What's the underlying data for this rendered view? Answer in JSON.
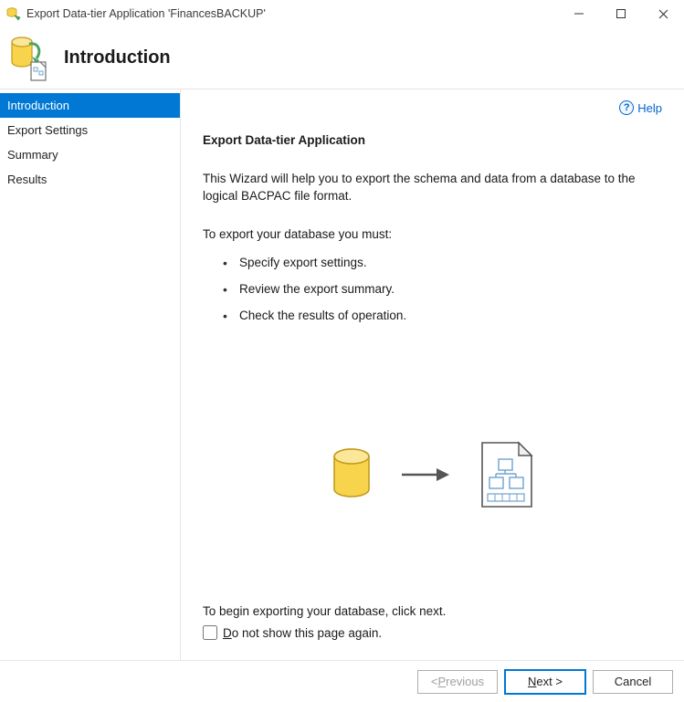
{
  "window": {
    "title": "Export Data-tier Application 'FinancesBACKUP'"
  },
  "header": {
    "title": "Introduction"
  },
  "sidebar": {
    "items": [
      {
        "label": "Introduction",
        "active": true
      },
      {
        "label": "Export Settings",
        "active": false
      },
      {
        "label": "Summary",
        "active": false
      },
      {
        "label": "Results",
        "active": false
      }
    ]
  },
  "help": {
    "label": "Help"
  },
  "content": {
    "heading": "Export Data-tier Application",
    "intro_text": "This Wizard will help you to export the schema and data from a database to the logical BACPAC file format.",
    "steps_lead": "To export your database you must:",
    "steps": [
      "Specify export settings.",
      "Review the export summary.",
      "Check the results of operation."
    ],
    "begin_text": "To begin exporting your database, click next.",
    "checkbox_label": "Do not show this page again."
  },
  "footer": {
    "previous_key": "P",
    "previous_rest": "revious",
    "previous_prefix": "< ",
    "next_key": "N",
    "next_rest": "ext >",
    "cancel": "Cancel"
  }
}
